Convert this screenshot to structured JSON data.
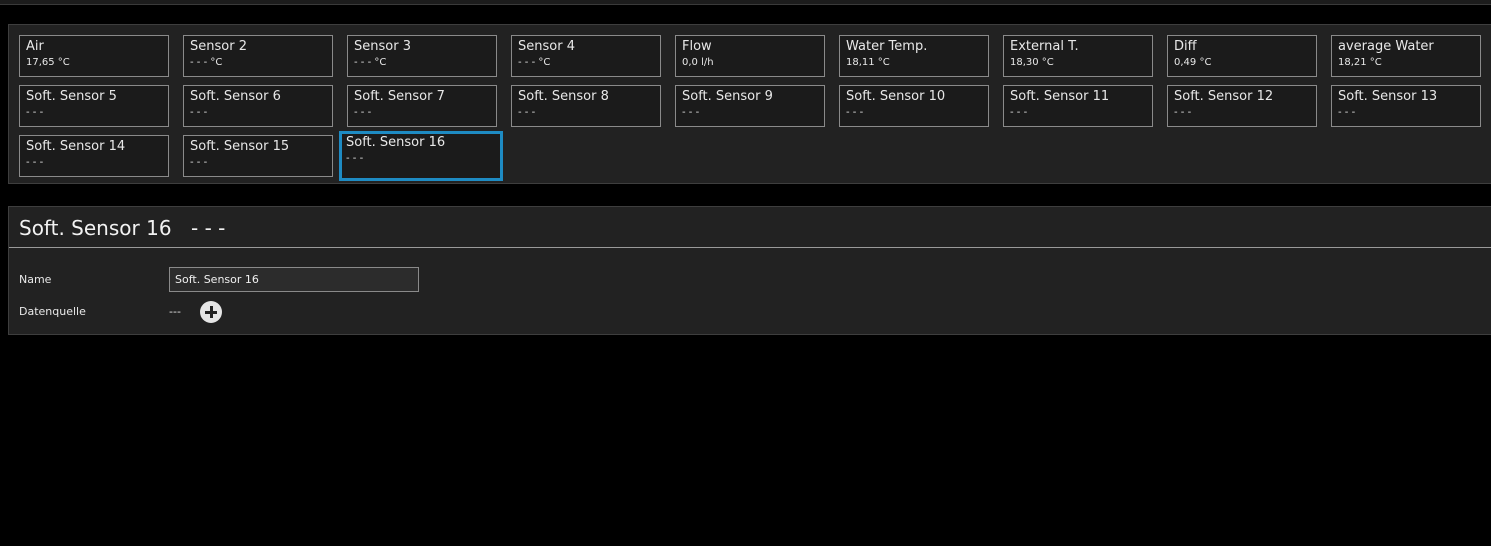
{
  "sensors": [
    {
      "label": "Air",
      "value": "17,65 °C"
    },
    {
      "label": "Sensor 2",
      "value": "- - - °C"
    },
    {
      "label": "Sensor 3",
      "value": "- - - °C"
    },
    {
      "label": "Sensor 4",
      "value": "- - - °C"
    },
    {
      "label": "Flow",
      "value": "0,0 l/h"
    },
    {
      "label": "Water Temp.",
      "value": "18,11 °C"
    },
    {
      "label": "External T.",
      "value": "18,30 °C"
    },
    {
      "label": "Diff",
      "value": "0,49 °C"
    },
    {
      "label": "average Water",
      "value": "18,21 °C"
    },
    {
      "label": "Soft. Sensor 5",
      "value": "- - -"
    },
    {
      "label": "Soft. Sensor 6",
      "value": "- - -"
    },
    {
      "label": "Soft. Sensor 7",
      "value": "- - -"
    },
    {
      "label": "Soft. Sensor 8",
      "value": "- - -"
    },
    {
      "label": "Soft. Sensor 9",
      "value": "- - -"
    },
    {
      "label": "Soft. Sensor 10",
      "value": "- - -"
    },
    {
      "label": "Soft. Sensor 11",
      "value": "- - -"
    },
    {
      "label": "Soft. Sensor 12",
      "value": "- - -"
    },
    {
      "label": "Soft. Sensor 13",
      "value": "- - -"
    },
    {
      "label": "Soft. Sensor 14",
      "value": "- - -"
    },
    {
      "label": "Soft. Sensor 15",
      "value": "- - -"
    },
    {
      "label": "Soft. Sensor 16",
      "value": "- - -"
    }
  ],
  "selected_index": 20,
  "detail": {
    "title": "Soft. Sensor 16",
    "value": "- - -",
    "name_label": "Name",
    "name_value": "Soft. Sensor 16",
    "source_label": "Datenquelle",
    "source_value": "---",
    "add_icon": "plus-circle-icon"
  },
  "colors": {
    "selection_border": "#1e8bc3",
    "background": "#000000",
    "panel": "#222222"
  }
}
